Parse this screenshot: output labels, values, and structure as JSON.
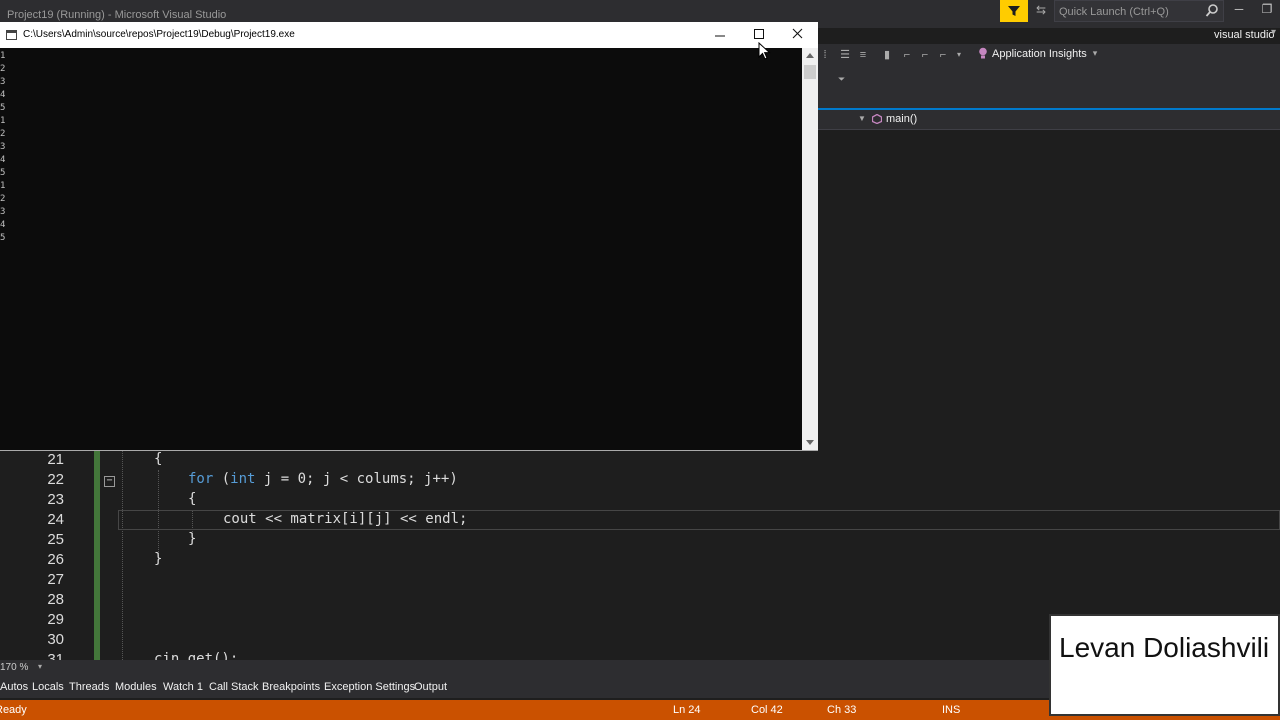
{
  "vs": {
    "title": "Project19 (Running) - Microsoft Visual Studio",
    "quick_launch_placeholder": "Quick Launch (Ctrl+Q)",
    "account": "visual studio",
    "toolbar": {
      "app_insights": "Application Insights"
    },
    "nav": {
      "member": "main()"
    },
    "zoom": "170 %"
  },
  "console": {
    "path": "C:\\Users\\Admin\\source\\repos\\Project19\\Debug\\Project19.exe",
    "output": [
      "1",
      "2",
      "3",
      "4",
      "5",
      "1",
      "2",
      "3",
      "4",
      "5",
      "1",
      "2",
      "3",
      "4",
      "5"
    ]
  },
  "editor": {
    "lines": [
      {
        "num": "21",
        "text": "{"
      },
      {
        "num": "22",
        "kw": "for",
        "text": " (",
        "kw2": "int",
        "rest": " j = 0; j < colums; j++)"
      },
      {
        "num": "23",
        "text": "{"
      },
      {
        "num": "24",
        "text": "cout << matrix[i][j] << endl;"
      },
      {
        "num": "25",
        "text": "}"
      },
      {
        "num": "26",
        "text": "}"
      },
      {
        "num": "27",
        "text": ""
      },
      {
        "num": "28",
        "text": ""
      },
      {
        "num": "29",
        "text": ""
      },
      {
        "num": "30",
        "text": ""
      },
      {
        "num": "31",
        "text": "cin.get();"
      }
    ]
  },
  "bottom_tabs": [
    "Autos",
    "Locals",
    "Threads",
    "Modules",
    "Watch 1",
    "Call Stack",
    "Breakpoints",
    "Exception Settings",
    "Output"
  ],
  "status": {
    "state": "Ready",
    "ln": "Ln 24",
    "col": "Col 42",
    "ch": "Ch 33",
    "mode": "INS"
  },
  "overlay": {
    "name": "Levan Doliashvili"
  },
  "colors": {
    "status_bar": "#ca5100",
    "accent": "#007acc",
    "feedback": "#ffcc00",
    "keyword": "#569cd6"
  }
}
